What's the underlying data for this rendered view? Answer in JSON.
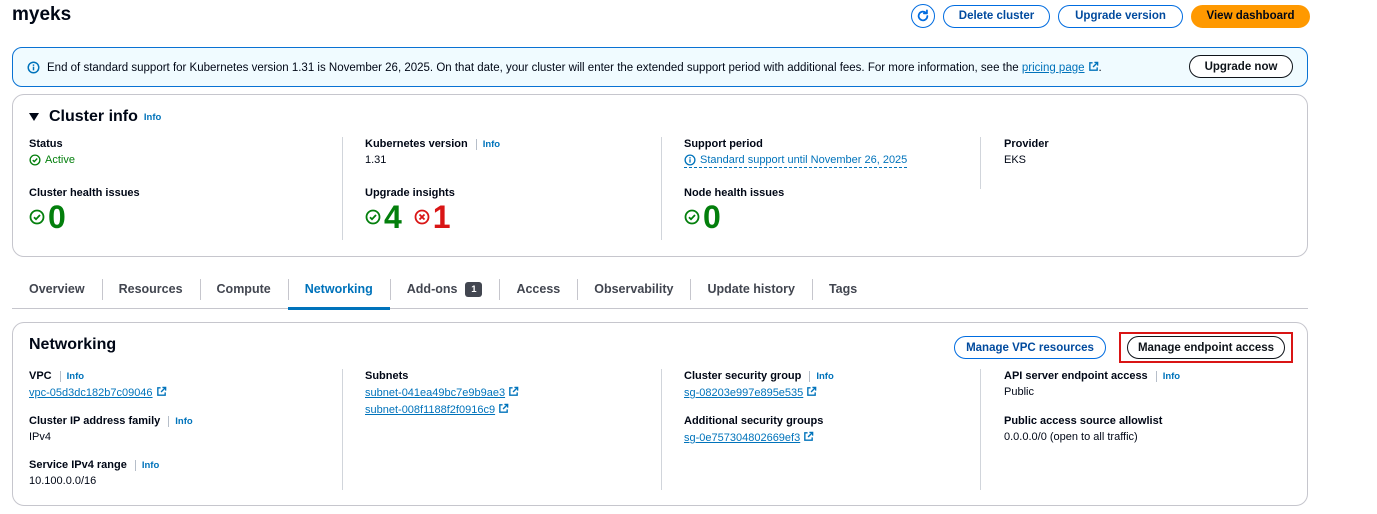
{
  "header": {
    "title": "myeks",
    "delete_label": "Delete cluster",
    "upgrade_label": "Upgrade version",
    "dashboard_label": "View dashboard"
  },
  "alert": {
    "text_before": "End of standard support for Kubernetes version 1.31 is November 26, 2025. On that date, your cluster will enter the extended support period with additional fees. For more information, see the ",
    "link_text": "pricing page",
    "text_after": ".",
    "button_label": "Upgrade now"
  },
  "cluster_info": {
    "title": "Cluster info",
    "info": "Info",
    "status_label": "Status",
    "status_value": "Active",
    "k8s_label": "Kubernetes version",
    "k8s_value": "1.31",
    "support_label": "Support period",
    "support_value": "Standard support until November 26, 2025",
    "provider_label": "Provider",
    "provider_value": "EKS",
    "health_label": "Cluster health issues",
    "health_value": "0",
    "insights_label": "Upgrade insights",
    "insights_pass": "4",
    "insights_fail": "1",
    "node_label": "Node health issues",
    "node_value": "0"
  },
  "tabs": [
    {
      "label": "Overview"
    },
    {
      "label": "Resources"
    },
    {
      "label": "Compute"
    },
    {
      "label": "Networking"
    },
    {
      "label": "Add-ons",
      "badge": "1"
    },
    {
      "label": "Access"
    },
    {
      "label": "Observability"
    },
    {
      "label": "Update history"
    },
    {
      "label": "Tags"
    }
  ],
  "networking": {
    "title": "Networking",
    "manage_vpc_label": "Manage VPC resources",
    "manage_endpoint_label": "Manage endpoint access",
    "info": "Info",
    "vpc_label": "VPC",
    "vpc_value": "vpc-05d3dc182b7c09046",
    "ip_family_label": "Cluster IP address family",
    "ip_family_value": "IPv4",
    "service_range_label": "Service IPv4 range",
    "service_range_value": "10.100.0.0/16",
    "subnets_label": "Subnets",
    "subnets": [
      "subnet-041ea49bc7e9b9ae3",
      "subnet-008f1188f2f0916c9"
    ],
    "csg_label": "Cluster security group",
    "csg_value": "sg-08203e997e895e535",
    "asg_label": "Additional security groups",
    "asg_value": "sg-0e757304802669ef3",
    "endpoint_label": "API server endpoint access",
    "endpoint_value": "Public",
    "allowlist_label": "Public access source allowlist",
    "allowlist_value": "0.0.0.0/0 (open to all traffic)"
  }
}
